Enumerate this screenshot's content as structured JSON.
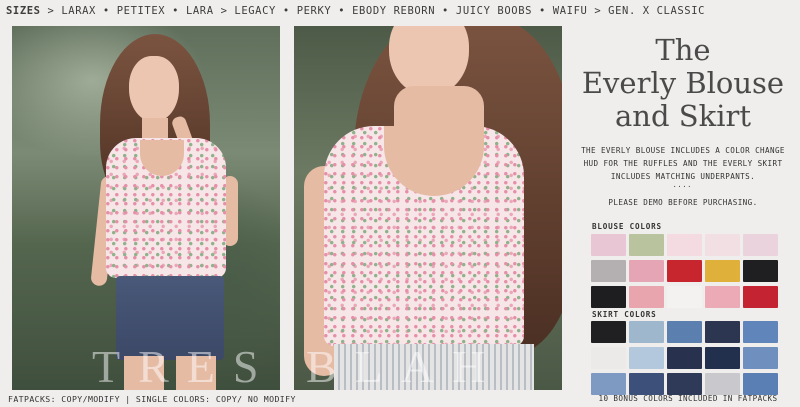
{
  "sizes": {
    "label": "SIZES",
    "list": "> LARAX • PETITEX • LARA > LEGACY • PERKY • EBODY REBORN • JUICY BOOBS • WAIFU > GEN. X CLASSIC"
  },
  "watermark": "TRES BLAH",
  "title": {
    "line1": "The",
    "line2": "Everly Blouse",
    "line3": "and Skirt"
  },
  "description": "THE EVERLY BLOUSE INCLUDES A COLOR CHANGE HUD FOR THE RUFFLES AND THE EVERLY SKIRT INCLUDES MATCHING UNDERPANTS.",
  "dots": "....",
  "demo_note": "PLEASE DEMO BEFORE PURCHASING.",
  "blouse_colors": {
    "label": "BLOUSE COLORS",
    "swatches": [
      "#e8c6d4",
      "#b9c49f",
      "#f4dbe1",
      "#f2dfe4",
      "#ead3dc",
      "#b4b0b2",
      "#e6a5b5",
      "#c8262f",
      "#e0b13a",
      "#1f1f22",
      "#1e1e21",
      "#e9a5ae",
      "#f4f2f0",
      "#ecaab6",
      "#c42432"
    ]
  },
  "skirt_colors": {
    "label": "SKIRT COLORS",
    "swatches": [
      "#202022",
      "#9fb7cd",
      "#5b7fae",
      "#2c3650",
      "#5f85ba",
      "#eceae8",
      "#b4c8dd",
      "#28324f",
      "#23304d",
      "#6f8fbe",
      "#7f9ac2",
      "#3d5079",
      "#2f3a59",
      "#c9c9cd",
      "#5a7fb4"
    ]
  },
  "footer_left": "FATPACKS: COPY/MODIFY | SINGLE COLORS: COPY/ NO MODIFY",
  "footer_right": "10 BONUS COLORS INCLUDED IN FATPACKS"
}
